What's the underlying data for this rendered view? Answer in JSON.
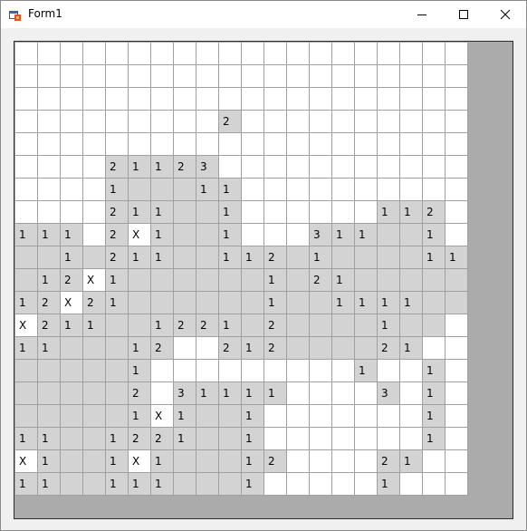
{
  "window": {
    "title": "Form1",
    "icons": {
      "app": "winforms-app-icon",
      "minimize": "minimize-icon",
      "maximize": "maximize-icon",
      "close": "close-icon"
    }
  },
  "board": {
    "cols": 20,
    "legend": {
      ".": "hidden",
      "_": "revealed-empty",
      "1-8": "revealed-number",
      "X": "flagged"
    },
    "colors": {
      "hidden": "#ffffff",
      "revealed": "#d3d3d3",
      "gridline": "#a0a0a0",
      "background": "#ababab"
    },
    "rows": [
      "....................",
      "....................",
      "....................",
      ".........2..........",
      "....................",
      "....21123...........",
      "....1___11..........",
      "....211__1......112.",
      "111.2X1__1...311__1.",
      "__1_211__112_1____111",
      "_12X1______1_21_____",
      "12X21______1__1111__",
      "X211__1221_2____1__",
      "11___12..212____21.",
      "_____1.........1..1.",
      "_____2.31111....3.1.",
      "_____1X1__1.......1.",
      "11__1221__1.......1.",
      "X1__1X1___12....21..",
      "11__111___1.....1..."
    ]
  }
}
